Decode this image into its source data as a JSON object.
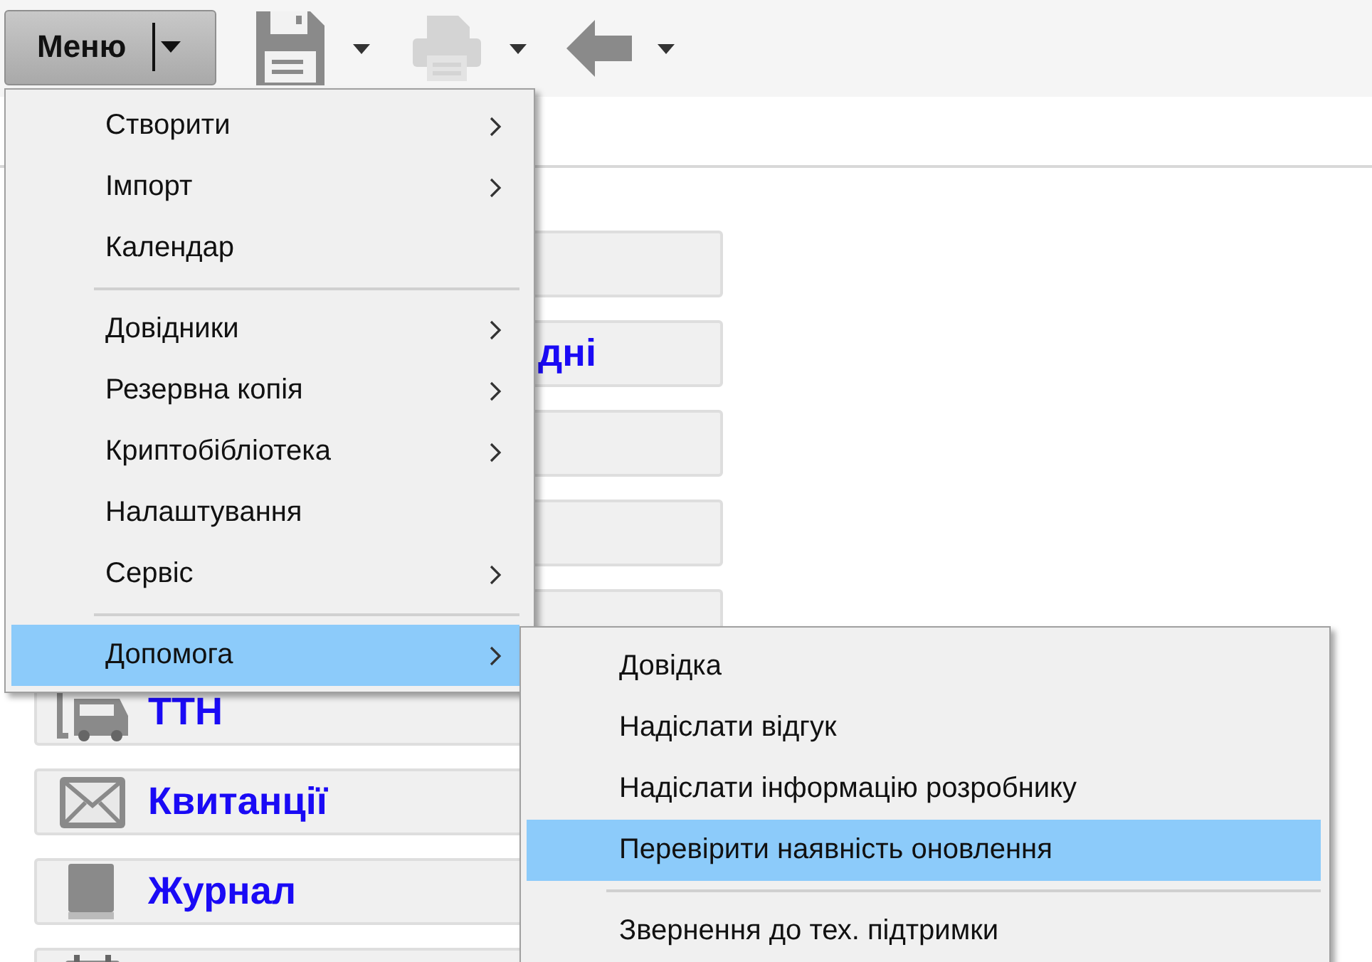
{
  "toolbar": {
    "menu_button": {
      "label": "Меню"
    },
    "tools": [
      {
        "kind": "save",
        "disabled": false
      },
      {
        "kind": "print",
        "disabled": true
      },
      {
        "kind": "back",
        "disabled": false
      }
    ]
  },
  "sidebar": {
    "items": [
      {
        "kind": "blank"
      },
      {
        "kind": "cut",
        "label": "дні"
      },
      {
        "kind": "blank"
      },
      {
        "kind": "blank"
      },
      {
        "kind": "blank"
      },
      {
        "kind": "truck",
        "label": "ТТН"
      },
      {
        "kind": "envelope",
        "label": "Квитанції"
      },
      {
        "kind": "book",
        "label": "Журнал"
      },
      {
        "kind": "calendar"
      }
    ]
  },
  "menu": {
    "items": [
      {
        "kind": "item",
        "label": "Створити",
        "submenu": true,
        "selected": false
      },
      {
        "kind": "item",
        "label": "Імпорт",
        "submenu": true,
        "selected": false
      },
      {
        "kind": "item",
        "label": "Календар",
        "submenu": false,
        "selected": false
      },
      {
        "kind": "separator"
      },
      {
        "kind": "item",
        "label": "Довідники",
        "submenu": true,
        "selected": false
      },
      {
        "kind": "item",
        "label": "Резервна копія",
        "submenu": true,
        "selected": false
      },
      {
        "kind": "item",
        "label": "Криптобібліотека",
        "submenu": true,
        "selected": false
      },
      {
        "kind": "item",
        "label": "Налаштування",
        "submenu": false,
        "selected": false
      },
      {
        "kind": "item",
        "label": "Сервіс",
        "submenu": true,
        "selected": false
      },
      {
        "kind": "separator"
      },
      {
        "kind": "item",
        "label": "Допомога",
        "submenu": true,
        "selected": true
      }
    ]
  },
  "submenu": {
    "items": [
      {
        "kind": "item",
        "label": "Довідка",
        "selected": false
      },
      {
        "kind": "item",
        "label": "Надіслати відгук",
        "selected": false
      },
      {
        "kind": "item",
        "label": "Надіслати інформацію розробнику",
        "selected": false
      },
      {
        "kind": "item",
        "label": "Перевірити наявність оновлення",
        "selected": true
      },
      {
        "kind": "separator"
      },
      {
        "kind": "item",
        "label": "Звернення до тех. підтримки",
        "selected": false
      }
    ]
  }
}
